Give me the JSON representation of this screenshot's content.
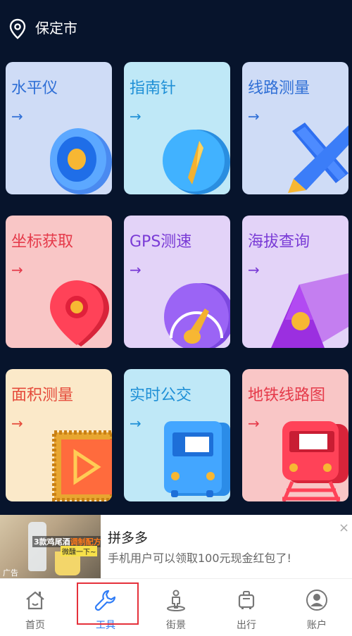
{
  "header": {
    "city": "保定市",
    "icon": "location-pin-icon"
  },
  "tools": [
    {
      "title": "水平仪",
      "arrow": "→",
      "icon": "level-icon",
      "title_color": "#2f6fd6",
      "bg": "#cfdcf6"
    },
    {
      "title": "指南针",
      "arrow": "→",
      "icon": "compass-icon",
      "title_color": "#1e8fd6",
      "bg": "#bfe8f7"
    },
    {
      "title": "线路测量",
      "arrow": "→",
      "icon": "route-measure-icon",
      "title_color": "#2f6fd6",
      "bg": "#cfdcf6"
    },
    {
      "title": "坐标获取",
      "arrow": "→",
      "icon": "coordinate-pin-icon",
      "title_color": "#e53a4a",
      "bg": "#f9c6c6"
    },
    {
      "title": "GPS测速",
      "arrow": "→",
      "icon": "speedometer-icon",
      "title_color": "#7a3bd6",
      "bg": "#e3d3f8"
    },
    {
      "title": "海拔查询",
      "arrow": "→",
      "icon": "altitude-mountain-icon",
      "title_color": "#7a3bd6",
      "bg": "#e3d3f8"
    },
    {
      "title": "面积测量",
      "arrow": "→",
      "icon": "area-measure-icon",
      "title_color": "#e54a3a",
      "bg": "#fbe9c9"
    },
    {
      "title": "实时公交",
      "arrow": "→",
      "icon": "bus-icon",
      "title_color": "#1e8fd6",
      "bg": "#bfe8f7"
    },
    {
      "title": "地铁线路图",
      "arrow": "→",
      "icon": "subway-icon",
      "title_color": "#e53a4a",
      "bg": "#f9c6c6"
    }
  ],
  "ad": {
    "image_text_1": "3款鸡尾酒",
    "image_text_2": "调制配方",
    "image_text_3": "微醺一下~",
    "tag": "广告",
    "title": "拼多多",
    "description": "手机用户可以领取100元现金红包了!",
    "close": "×"
  },
  "tabbar": [
    {
      "label": "首页",
      "icon": "home-icon",
      "active": false
    },
    {
      "label": "工具",
      "icon": "wrench-icon",
      "active": true
    },
    {
      "label": "街景",
      "icon": "street-view-icon",
      "active": false
    },
    {
      "label": "出行",
      "icon": "luggage-icon",
      "active": false
    },
    {
      "label": "账户",
      "icon": "account-icon",
      "active": false
    }
  ],
  "colors": {
    "background": "#07142c",
    "active_tab": "#2f7cf6",
    "highlight": "#e5313b"
  }
}
